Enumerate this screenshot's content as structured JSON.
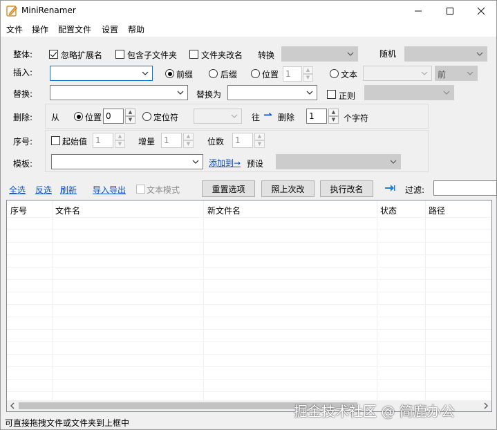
{
  "window": {
    "title": "MiniRenamer"
  },
  "menu": [
    "文件",
    "操作",
    "配置文件",
    "设置",
    "帮助"
  ],
  "overall": {
    "label": "整体:",
    "ignore_ext": "忽略扩展名",
    "include_subfolders": "包含子文件夹",
    "rename_folders": "文件夹改名",
    "convert_label": "转换",
    "random_label": "随机"
  },
  "insert": {
    "label": "插入:",
    "prefix": "前缀",
    "suffix": "后缀",
    "position": "位置",
    "position_value": "1",
    "text": "文本",
    "direction": "前"
  },
  "replace": {
    "label": "替换:",
    "replace_with": "替换为",
    "regex": "正则"
  },
  "delete": {
    "label": "删除:",
    "from": "从",
    "position": "位置",
    "position_value": "0",
    "locator": "定位符",
    "towards": "往",
    "arrow": "⇀",
    "delete": "删除",
    "count_value": "1",
    "chars": "个字符"
  },
  "sequence": {
    "label": "序号:",
    "start": "起始值",
    "start_value": "1",
    "increment": "增量",
    "increment_value": "1",
    "digits": "位数",
    "digits_value": "1"
  },
  "template": {
    "label": "模板:",
    "add_to": "添加到→",
    "preset": "预设"
  },
  "toolbar": {
    "select_all": "全选",
    "invert": "反选",
    "refresh": "刷新",
    "import_export": "导入导出",
    "text_mode": "文本模式",
    "reset": "重置选项",
    "redo_last": "照上次改",
    "execute": "执行改名",
    "filter_label": "过滤:"
  },
  "table": {
    "columns": [
      "序号",
      "文件名",
      "新文件名",
      "状态",
      "路径"
    ]
  },
  "status": "可直接拖拽文件或文件夹到上框中",
  "watermark": "掘金技术社区 @ 简鹿办公"
}
